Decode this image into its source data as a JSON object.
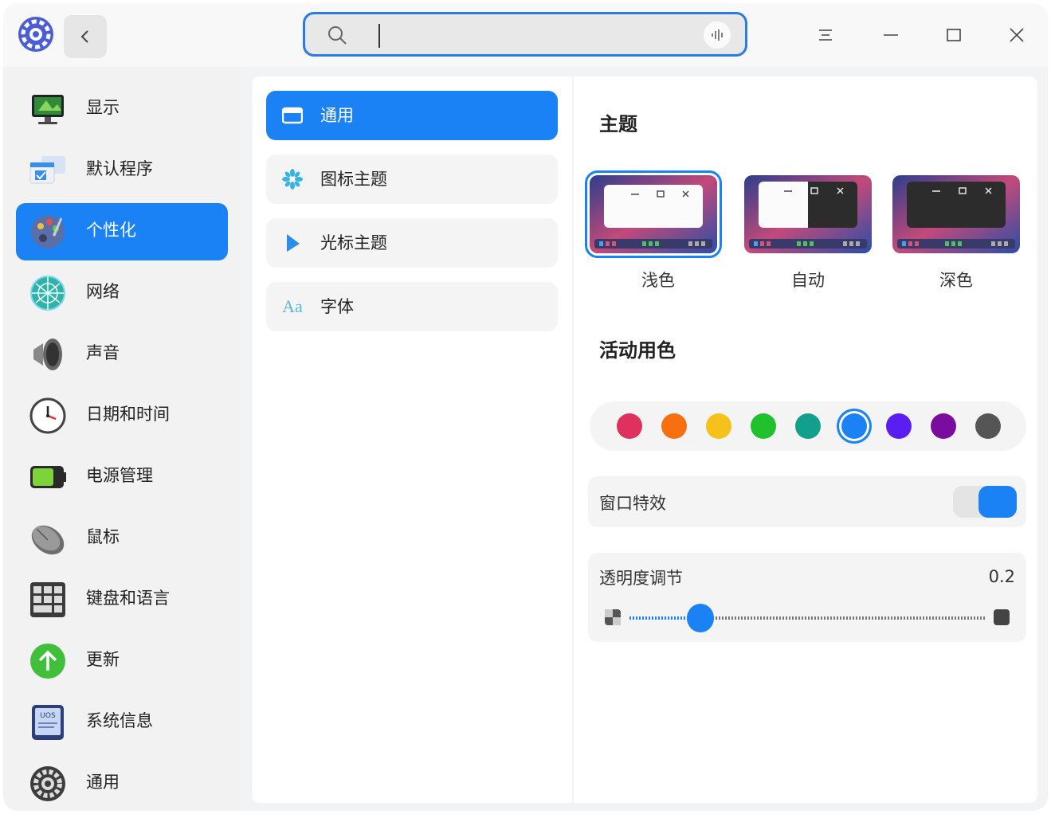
{
  "titlebar": {
    "search": {
      "value": "",
      "placeholder": ""
    }
  },
  "sidebar": {
    "items": [
      {
        "label": "显示",
        "icon": "display-icon"
      },
      {
        "label": "默认程序",
        "icon": "default-apps-icon"
      },
      {
        "label": "个性化",
        "icon": "personalization-icon",
        "active": true
      },
      {
        "label": "网络",
        "icon": "network-icon"
      },
      {
        "label": "声音",
        "icon": "sound-icon"
      },
      {
        "label": "日期和时间",
        "icon": "clock-icon"
      },
      {
        "label": "电源管理",
        "icon": "battery-icon"
      },
      {
        "label": "鼠标",
        "icon": "mouse-icon"
      },
      {
        "label": "键盘和语言",
        "icon": "keyboard-icon"
      },
      {
        "label": "更新",
        "icon": "update-icon"
      },
      {
        "label": "系统信息",
        "icon": "system-info-icon"
      },
      {
        "label": "通用",
        "icon": "general-gear-icon"
      }
    ],
    "system_info_badge": "UOS"
  },
  "submenu": {
    "items": [
      {
        "label": "通用",
        "icon": "window-icon",
        "active": true
      },
      {
        "label": "图标主题",
        "icon": "icon-theme-icon"
      },
      {
        "label": "光标主题",
        "icon": "cursor-icon"
      },
      {
        "label": "字体",
        "icon": "font-icon",
        "glyph": "Aa"
      }
    ]
  },
  "content": {
    "theme_title": "主题",
    "themes": [
      {
        "label": "浅色",
        "selected": true
      },
      {
        "label": "自动",
        "selected": false
      },
      {
        "label": "深色",
        "selected": false
      }
    ],
    "accent_title": "活动用色",
    "accent_colors": [
      "#e0305e",
      "#f76f0f",
      "#f7c11b",
      "#1fc12c",
      "#12a08c",
      "#1a82f5",
      "#5a1ef0",
      "#7b0d9e",
      "#555555"
    ],
    "accent_selected_index": 5,
    "window_effects": {
      "label": "窗口特效",
      "enabled": true
    },
    "transparency": {
      "label": "透明度调节",
      "value_text": "0.2",
      "value": 0.2
    }
  }
}
